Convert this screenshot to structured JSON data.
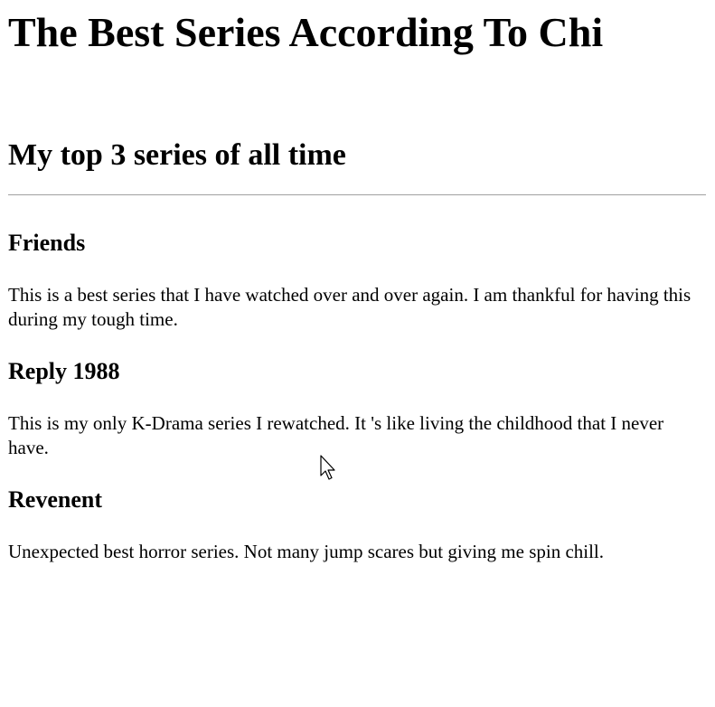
{
  "page": {
    "title": "The Best Series According To Chi",
    "subtitle": "My top 3 series of all time"
  },
  "series": [
    {
      "name": "Friends",
      "description": "This is a best series that I have watched over and over again. I am thankful for having this during my tough time."
    },
    {
      "name": "Reply 1988",
      "description": "This is my only K-Drama series I rewatched. It 's like living the childhood that I never have."
    },
    {
      "name": "Revenent",
      "description": "Unexpected best horror series. Not many jump scares but giving me spin chill."
    }
  ],
  "icons": {
    "cursor": "mouse-pointer-icon"
  },
  "colors": {
    "text": "#000000",
    "divider": "#a0a0a0",
    "background": "#ffffff"
  }
}
